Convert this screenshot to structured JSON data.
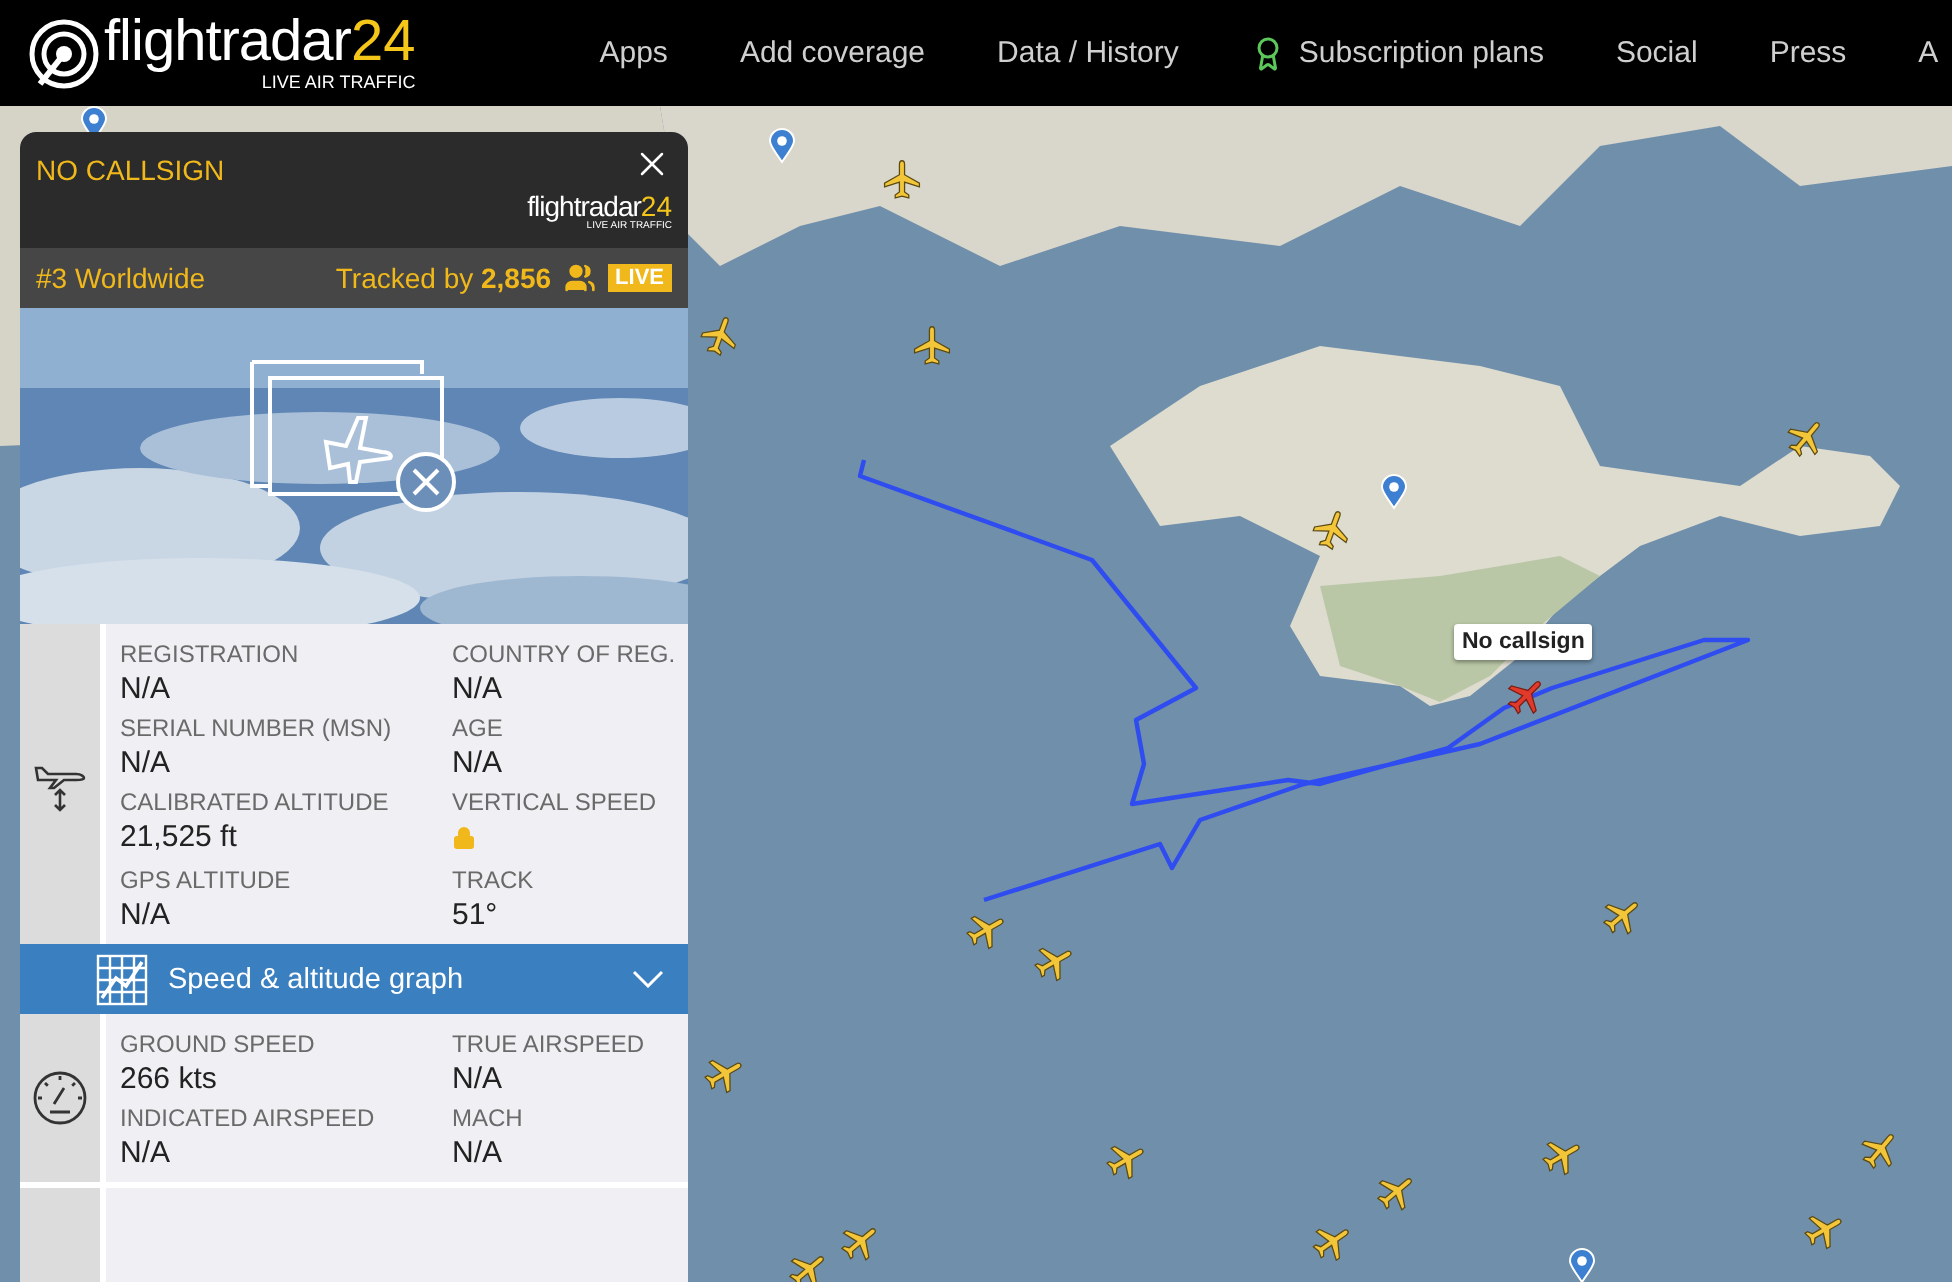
{
  "header": {
    "logo": {
      "word": "flightradar",
      "number": "24",
      "tagline": "LIVE AIR TRAFFIC"
    },
    "nav": [
      {
        "label": "Apps",
        "kind": "text"
      },
      {
        "label": "Add coverage",
        "kind": "text"
      },
      {
        "label": "Data / History",
        "kind": "text"
      },
      {
        "label": "Subscription plans",
        "kind": "award"
      },
      {
        "label": "Social",
        "kind": "text"
      },
      {
        "label": "Press",
        "kind": "text"
      },
      {
        "label": "A",
        "kind": "text"
      }
    ]
  },
  "panel": {
    "callsign": "NO CALLSIGN",
    "logo": {
      "word": "flightradar",
      "number": "24",
      "tagline": "LIVE AIR TRAFFIC"
    },
    "rank": "#3 Worldwide",
    "tracked": "Tracked by **2,856**",
    "live": "LIVE",
    "altitude_section": {
      "kind": "altitude",
      "fields": [
        {
          "label": "REGISTRATION",
          "value": "N/A",
          "kind": "text"
        },
        {
          "label": "COUNTRY OF REG.",
          "value": "N/A",
          "kind": "text"
        },
        {
          "label": "SERIAL NUMBER (MSN)",
          "value": "N/A",
          "kind": "text"
        },
        {
          "label": "AGE",
          "value": "N/A",
          "kind": "text"
        },
        {
          "label": "CALIBRATED ALTITUDE",
          "value": "21,525 ft",
          "kind": "text"
        },
        {
          "label": "VERTICAL SPEED",
          "kind": "locked"
        },
        {
          "label": "GPS ALTITUDE",
          "value": "N/A",
          "kind": "text"
        },
        {
          "label": "TRACK",
          "value": "51°",
          "kind": "text"
        }
      ]
    },
    "graph": {
      "label": "Speed & altitude graph",
      "expanded": false
    },
    "speed_section": {
      "kind": "speed",
      "fields": [
        {
          "label": "GROUND SPEED",
          "value": "266 kts",
          "kind": "text"
        },
        {
          "label": "TRUE AIRSPEED",
          "value": "N/A",
          "kind": "text"
        },
        {
          "label": "INDICATED AIRSPEED",
          "value": "N/A",
          "kind": "text"
        },
        {
          "label": "MACH",
          "value": "N/A",
          "kind": "text"
        }
      ]
    }
  },
  "map": {
    "callout": "No callsign",
    "aircraft": [
      {
        "selected": false
      },
      {
        "selected": false
      },
      {
        "selected": false
      },
      {
        "selected": false
      },
      {
        "selected": false
      },
      {
        "selected": true
      },
      {
        "selected": false
      },
      {
        "selected": false
      },
      {
        "selected": false
      },
      {
        "selected": false
      },
      {
        "selected": false
      },
      {
        "selected": false
      },
      {
        "selected": false
      },
      {
        "selected": false
      },
      {
        "selected": false
      },
      {
        "selected": false
      },
      {
        "selected": false
      },
      {
        "selected": false
      }
    ]
  }
}
